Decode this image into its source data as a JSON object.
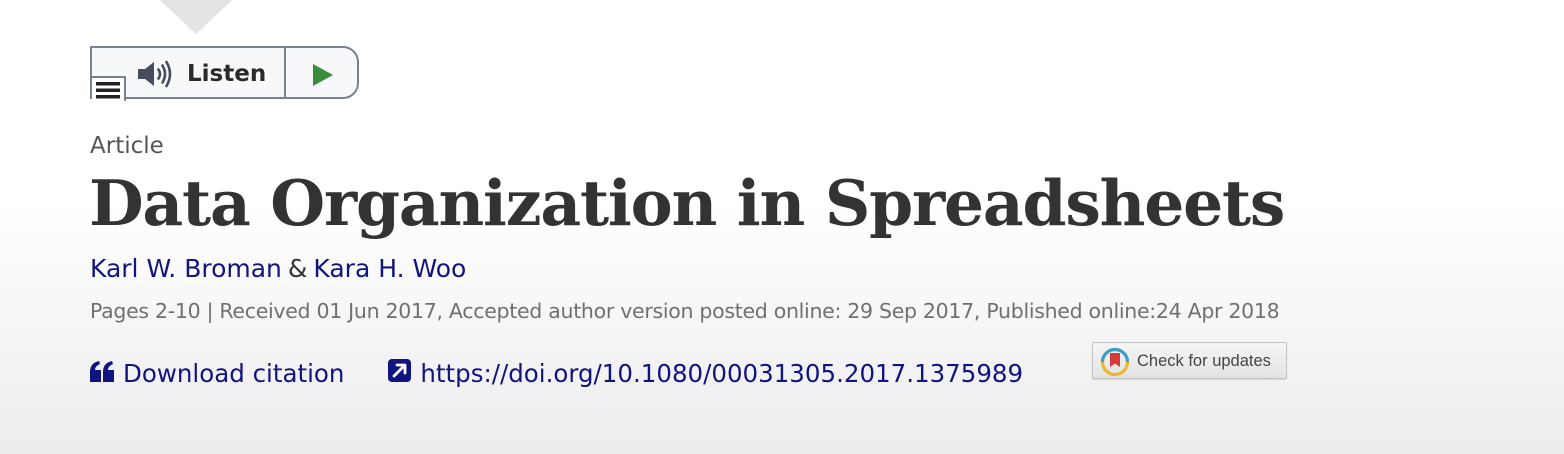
{
  "listen_widget": {
    "label": "Listen",
    "menu_icon": "hamburger-menu-icon",
    "speaker_icon": "speaker-volume-icon",
    "play_icon": "play-icon",
    "play_color": "#3a8d3c"
  },
  "article": {
    "type": "Article",
    "title": "Data Organization in Spreadsheets",
    "authors": [
      {
        "name": "Karl W. Broman"
      },
      {
        "name": "Kara H. Woo"
      }
    ],
    "author_separator": "&",
    "pub_info": "Pages 2-10 | Received 01 Jun 2017, Accepted author version posted online: 29 Sep 2017, Published online:24 Apr 2018"
  },
  "links": {
    "download_citation_label": "Download citation",
    "download_citation_icon": "quote-icon",
    "doi_url": "https://doi.org/10.1080/00031305.2017.1375989",
    "doi_icon": "external-link-icon",
    "check_updates_label": "Check for updates",
    "check_updates_icon": "crossmark-icon"
  },
  "colors": {
    "link": "#10147e",
    "title": "#333333",
    "meta_text": "#707070"
  }
}
